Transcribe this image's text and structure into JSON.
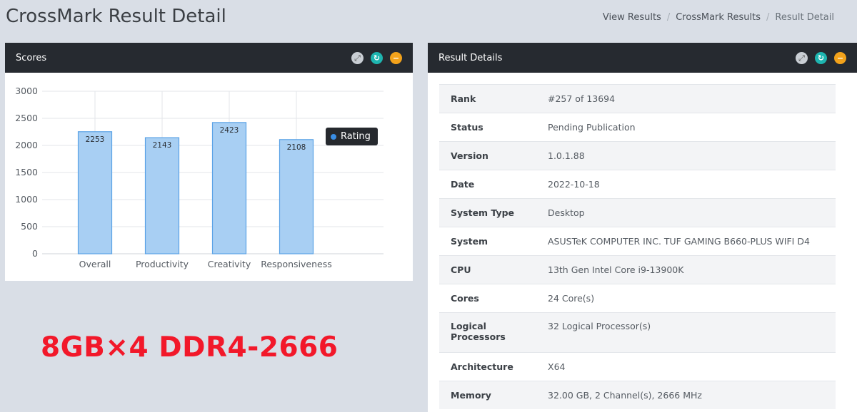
{
  "header": {
    "title": "CrossMark Result Detail",
    "breadcrumb": [
      {
        "label": "View Results"
      },
      {
        "label": "CrossMark Results"
      },
      {
        "label": "Result Detail"
      }
    ]
  },
  "scores_panel": {
    "title": "Scores",
    "legend": "Rating"
  },
  "details_panel": {
    "title": "Result Details",
    "rows": [
      {
        "label": "Rank",
        "value": "#257 of 13694"
      },
      {
        "label": "Status",
        "value": "Pending Publication"
      },
      {
        "label": "Version",
        "value": "1.0.1.88"
      },
      {
        "label": "Date",
        "value": "2022-10-18"
      },
      {
        "label": "System Type",
        "value": "Desktop"
      },
      {
        "label": "System",
        "value": "ASUSTeK COMPUTER INC. TUF GAMING B660-PLUS WIFI D4"
      },
      {
        "label": "CPU",
        "value": "13th Gen Intel Core i9-13900K"
      },
      {
        "label": "Cores",
        "value": "24 Core(s)"
      },
      {
        "label": "Logical Processors",
        "value": "32 Logical Processor(s)"
      },
      {
        "label": "Architecture",
        "value": "X64"
      },
      {
        "label": "Memory",
        "value": "32.00 GB, 2 Channel(s), 2666 MHz"
      }
    ]
  },
  "overlay_note": "8GB×4 DDR4-2666",
  "colors": {
    "status_pending": "#e8484a",
    "bar_fill": "#a8cff3",
    "bar_stroke": "#5aa2e6",
    "panel_header": "#262a30",
    "note": "#f2182a"
  },
  "icons": [
    "expand-icon",
    "reload-icon",
    "collapse-icon"
  ],
  "chart_data": {
    "type": "bar",
    "categories": [
      "Overall",
      "Productivity",
      "Creativity",
      "Responsiveness"
    ],
    "series": [
      {
        "name": "Rating",
        "values": [
          2253,
          2143,
          2423,
          2108
        ]
      }
    ],
    "ylim": [
      0,
      3000
    ],
    "yticks": [
      0,
      500,
      1000,
      1500,
      2000,
      2500,
      3000
    ],
    "grid": true,
    "legend": "top-right"
  }
}
